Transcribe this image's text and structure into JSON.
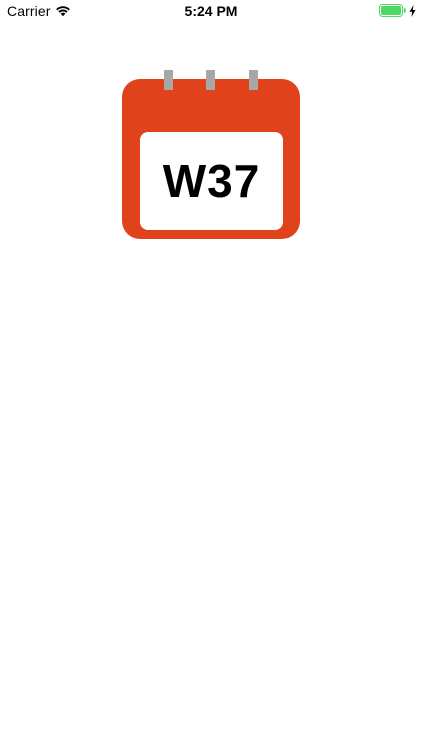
{
  "status_bar": {
    "carrier": "Carrier",
    "time": "5:24 PM",
    "icons": {
      "wifi": "wifi-icon",
      "battery": "battery-icon",
      "charging": "charging-bolt-icon"
    },
    "battery_level": 1.0,
    "battery_color": "#4cd964"
  },
  "calendar": {
    "week_label": "W37",
    "icon": "calendar-icon",
    "colors": {
      "frame": "#e0431b",
      "page": "#ffffff",
      "rings": "#a7a7a7",
      "text": "#000000"
    }
  }
}
